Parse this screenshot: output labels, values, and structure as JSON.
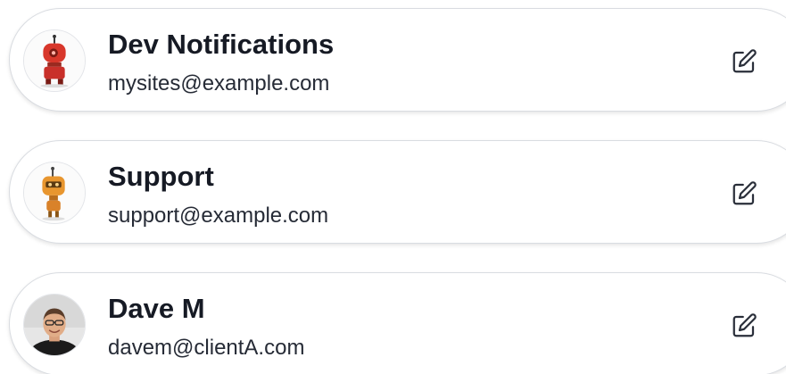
{
  "contacts": [
    {
      "name": "Dev Notifications",
      "email": "mysites@example.com",
      "avatar_icon": "red-robot-avatar-icon",
      "edit_icon": "edit-pencil-icon"
    },
    {
      "name": "Support",
      "email": "support@example.com",
      "avatar_icon": "orange-robot-avatar-icon",
      "edit_icon": "edit-pencil-icon"
    },
    {
      "name": "Dave M",
      "email": "davem@clientA.com",
      "avatar_icon": "user-photo-avatar",
      "edit_icon": "edit-pencil-icon"
    }
  ],
  "colors": {
    "name_text": "#161a24",
    "email_text": "#262b36",
    "card_border": "#d9dce1",
    "robot_red": "#d8372b",
    "robot_orange": "#e8962f"
  }
}
